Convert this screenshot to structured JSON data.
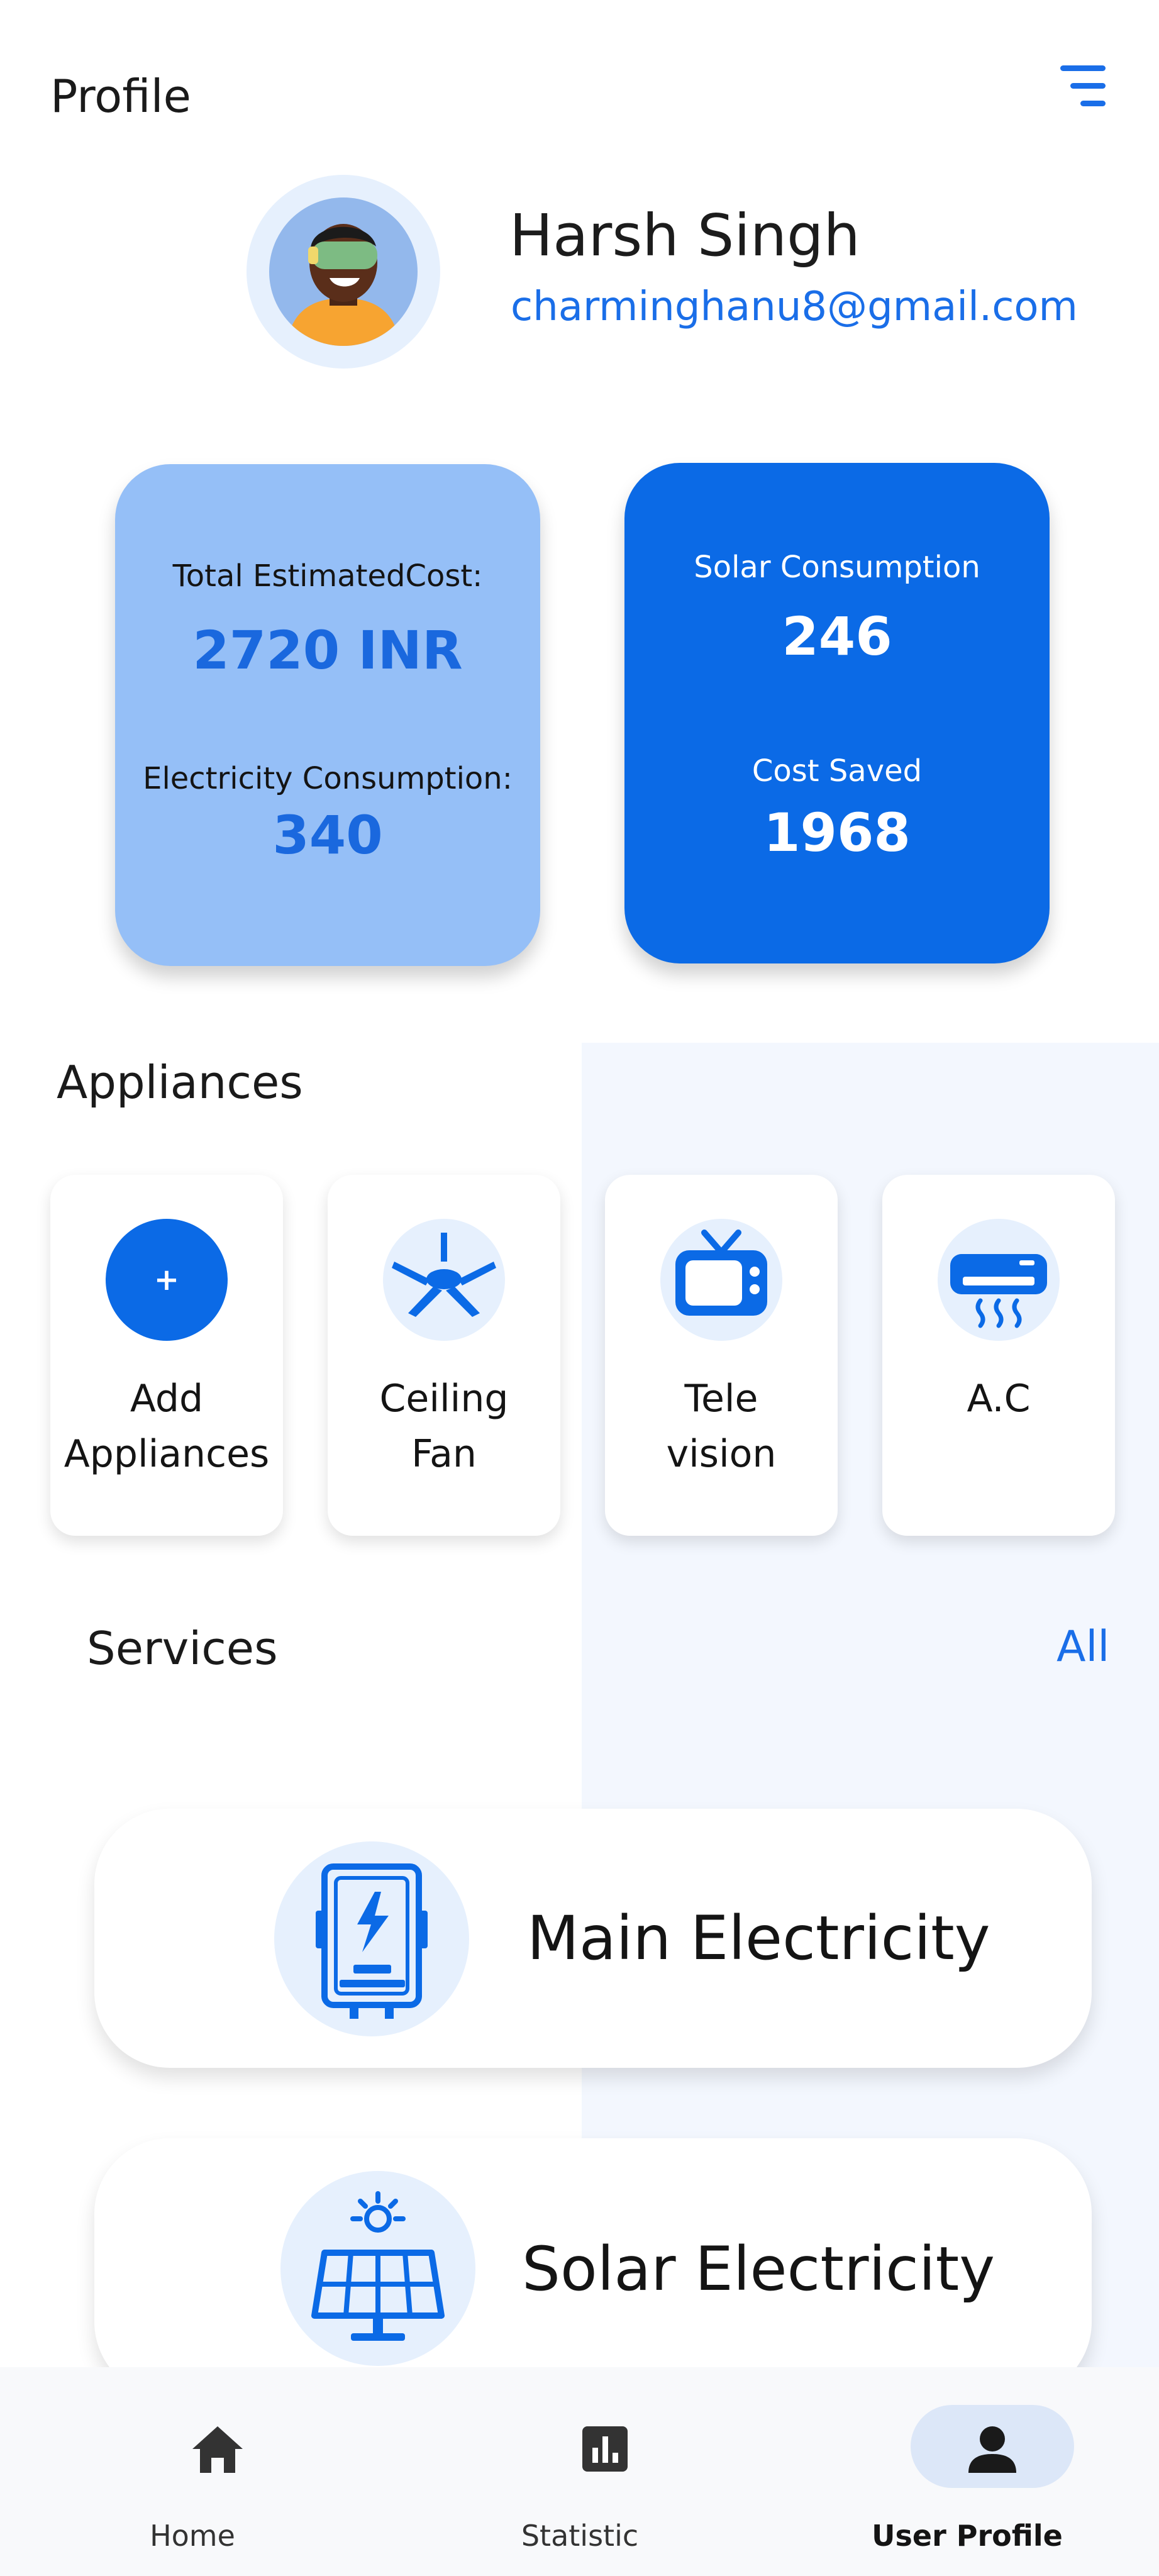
{
  "header": {
    "title": "Profile",
    "menu_icon": "menu-icon"
  },
  "user": {
    "name": "Harsh Singh",
    "email": "charminghanu8@gmail.com",
    "avatar_icon": "avatar-vr-headset"
  },
  "stats": {
    "total_cost_label": "Total EstimatedCost:",
    "total_cost_value": "2720 INR",
    "electricity_label": "Electricity Consumption:",
    "electricity_value": "340",
    "solar_label": "Solar Consumption",
    "solar_value": "246",
    "saved_label": "Cost Saved",
    "saved_value": "1968"
  },
  "appliances": {
    "title": "Appliances",
    "items": [
      {
        "line1": "Add",
        "line2": "Appliances",
        "icon": "plus-icon",
        "symbol": "+"
      },
      {
        "line1": "Ceiling",
        "line2": "Fan",
        "icon": "ceiling-fan-icon"
      },
      {
        "line1": "Tele",
        "line2": "vision",
        "icon": "television-icon"
      },
      {
        "line1": "A.C",
        "line2": "",
        "icon": "air-conditioner-icon"
      }
    ]
  },
  "services": {
    "title": "Services",
    "see_all": "All",
    "items": [
      {
        "label": "Main Electricity",
        "icon": "electric-meter-icon"
      },
      {
        "label": "Solar Electricity",
        "icon": "solar-panel-icon"
      }
    ]
  },
  "nav": {
    "items": [
      {
        "label": "Home",
        "icon": "home-icon"
      },
      {
        "label": "Statistic",
        "icon": "bar-chart-icon"
      },
      {
        "label": "User Profile",
        "icon": "user-icon",
        "active": true
      }
    ]
  },
  "colors": {
    "accent": "#0b6ae6",
    "card_light": "#95bff7",
    "icon_bg": "#e6f0fd"
  }
}
